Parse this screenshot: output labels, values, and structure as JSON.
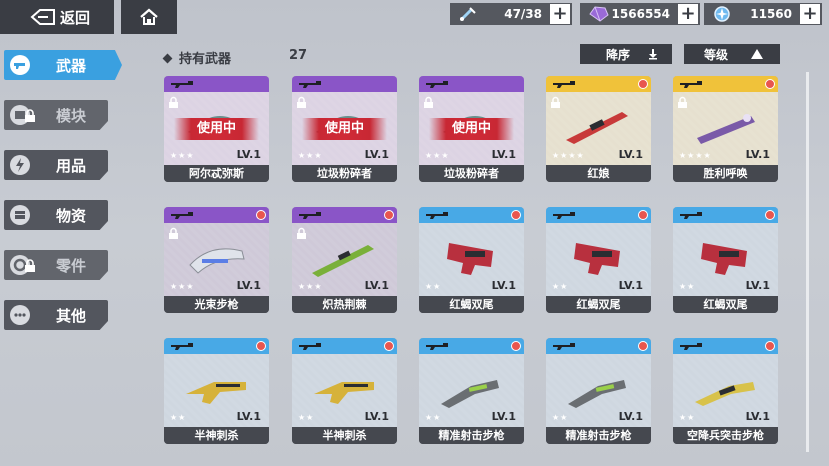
{
  "topbar": {
    "back_label": "返回",
    "resources": [
      {
        "name": "stamina",
        "icon": "syringe-icon",
        "value": "47/38"
      },
      {
        "name": "crystal",
        "icon": "purple-crystal-icon",
        "value": "1566554"
      },
      {
        "name": "coin",
        "icon": "blue-orb-icon",
        "value": "11560"
      }
    ]
  },
  "sidebar": {
    "items": [
      {
        "label": "武器",
        "state": "active",
        "icon": "gun-icon"
      },
      {
        "label": "模块",
        "state": "locked",
        "icon": "module-icon"
      },
      {
        "label": "用品",
        "state": "normal",
        "icon": "lightning-icon"
      },
      {
        "label": "物资",
        "state": "normal",
        "icon": "supply-icon"
      },
      {
        "label": "零件",
        "state": "locked",
        "icon": "gear-icon"
      },
      {
        "label": "其他",
        "state": "normal",
        "icon": "more-icon"
      }
    ]
  },
  "list": {
    "title": "持有武器",
    "count": "27",
    "sort_order_label": "降序",
    "sort_key_label": "等级"
  },
  "cards": [
    {
      "name": "阿尔忒弥斯",
      "rarity": "purple",
      "stars": 3,
      "level": "LV.1",
      "in_use": true,
      "in_use_label": "使用中",
      "locked": true,
      "weapon": "smg"
    },
    {
      "name": "垃圾粉碎者",
      "rarity": "purple",
      "stars": 3,
      "level": "LV.1",
      "in_use": true,
      "in_use_label": "使用中",
      "locked": true,
      "weapon": "smg"
    },
    {
      "name": "垃圾粉碎者",
      "rarity": "purple",
      "stars": 3,
      "level": "LV.1",
      "in_use": true,
      "in_use_label": "使用中",
      "locked": true,
      "weapon": "smg"
    },
    {
      "name": "红娘",
      "rarity": "gold",
      "stars": 4,
      "level": "LV.1",
      "in_use": false,
      "locked": true,
      "weapon": "sniper-red"
    },
    {
      "name": "胜利呼唤",
      "rarity": "gold",
      "stars": 4,
      "level": "LV.1",
      "in_use": false,
      "locked": true,
      "weapon": "sniper-purple"
    },
    {
      "name": "光束步枪",
      "rarity": "purple",
      "stars": 3,
      "level": "LV.1",
      "in_use": false,
      "locked": true,
      "weapon": "beam"
    },
    {
      "name": "炽热荆棘",
      "rarity": "purple",
      "stars": 3,
      "level": "LV.1",
      "in_use": false,
      "locked": true,
      "weapon": "green"
    },
    {
      "name": "红蝎双尾",
      "rarity": "blue",
      "stars": 2,
      "level": "LV.1",
      "in_use": false,
      "locked": false,
      "weapon": "red-smg"
    },
    {
      "name": "红蝎双尾",
      "rarity": "blue",
      "stars": 2,
      "level": "LV.1",
      "in_use": false,
      "locked": false,
      "weapon": "red-smg"
    },
    {
      "name": "红蝎双尾",
      "rarity": "blue",
      "stars": 2,
      "level": "LV.1",
      "in_use": false,
      "locked": false,
      "weapon": "red-smg"
    },
    {
      "name": "半神刺杀",
      "rarity": "blue",
      "stars": 2,
      "level": "LV.1",
      "in_use": false,
      "locked": false,
      "weapon": "gold-gun"
    },
    {
      "name": "半神刺杀",
      "rarity": "blue",
      "stars": 2,
      "level": "LV.1",
      "in_use": false,
      "locked": false,
      "weapon": "gold-gun"
    },
    {
      "name": "精准射击步枪",
      "rarity": "blue",
      "stars": 2,
      "level": "LV.1",
      "in_use": false,
      "locked": false,
      "weapon": "green-rifle"
    },
    {
      "name": "精准射击步枪",
      "rarity": "blue",
      "stars": 2,
      "level": "LV.1",
      "in_use": false,
      "locked": false,
      "weapon": "green-rifle"
    },
    {
      "name": "空降兵突击步枪",
      "rarity": "blue",
      "stars": 2,
      "level": "LV.1",
      "in_use": false,
      "locked": false,
      "weapon": "yellow-rifle"
    }
  ],
  "colors": {
    "purple": "#8a55c7",
    "gold": "#f0c23a",
    "blue": "#48a9e6",
    "accent": "#3aa0e0",
    "in_use": "#d02a37"
  }
}
